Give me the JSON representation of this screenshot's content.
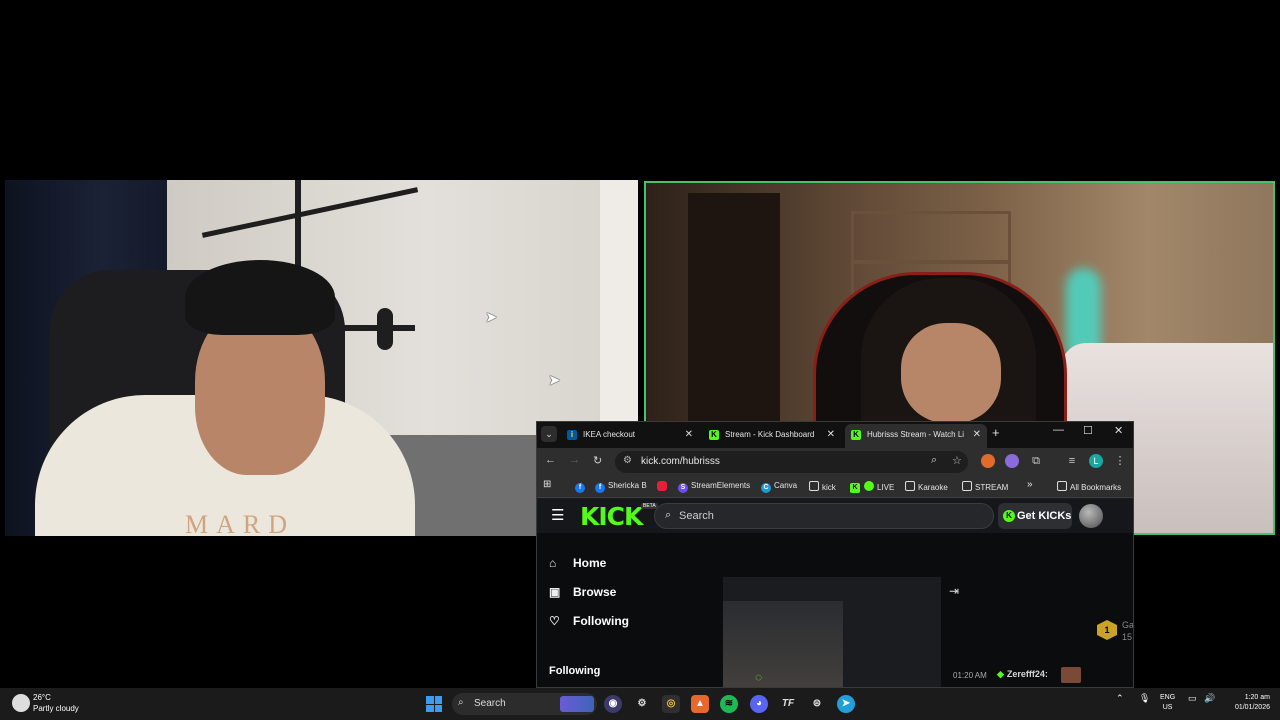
{
  "browser": {
    "tabs": [
      {
        "label": "IKEA checkout",
        "favicon": "ikea-icon",
        "active": false
      },
      {
        "label": "Stream - Kick Dashboard",
        "favicon": "kick-icon",
        "active": false
      },
      {
        "label": "Hubrisss Stream - Watch Li",
        "favicon": "kick-icon",
        "active": true
      }
    ],
    "url": "kick.com/hubrisss",
    "bookmarks": [
      {
        "label": "Shericka B",
        "icon": "facebook-icon",
        "color": "#1877f2"
      },
      {
        "label": "StreamElements",
        "icon": "streamelements-icon",
        "color": "#6c4cf5"
      },
      {
        "label": "Canva",
        "icon": "canva-icon",
        "color": "#1e9ad6"
      },
      {
        "label": "kick",
        "icon": "folder-icon",
        "color": ""
      },
      {
        "label": "LIVE",
        "icon": "live-icon",
        "color": "#53fc18"
      },
      {
        "label": "Karaoke",
        "icon": "folder-icon",
        "color": ""
      },
      {
        "label": "STREAM",
        "icon": "folder-icon",
        "color": ""
      },
      {
        "label": "All Bookmarks",
        "icon": "folder-icon",
        "color": ""
      }
    ],
    "profile_initial": "L"
  },
  "kick": {
    "logo": "KICK",
    "beta": "BETA",
    "search_placeholder": "Search",
    "get_kicks": "Get KICKs",
    "nav": [
      {
        "label": "Home",
        "icon": "home-icon"
      },
      {
        "label": "Browse",
        "icon": "browse-icon"
      },
      {
        "label": "Following",
        "icon": "heart-icon"
      }
    ],
    "following_heading": "Following",
    "badge_rank": "1",
    "badge_text_1": "Ga",
    "badge_text_2": "15",
    "chat": {
      "time": "01:20 AM",
      "user": "Zerefff24:"
    }
  },
  "taskbar": {
    "temp": "26°C",
    "weather": "Partly cloudy",
    "search_label": "Search",
    "lang_line1": "ENG",
    "lang_line2": "US",
    "time": "1:20 am",
    "date": "01/01/2026"
  },
  "camera_left": {
    "shirt_text": "MARD"
  },
  "colors": {
    "kick_green": "#53fc18",
    "cam_border": "#45c26a",
    "windows_blue": "#3b9cf2"
  }
}
